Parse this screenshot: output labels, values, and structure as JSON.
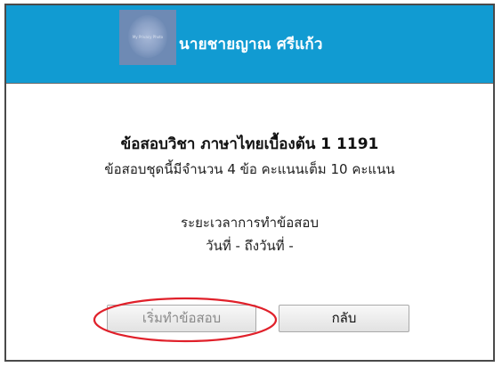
{
  "header": {
    "user_name": "นายชายญาณ ศรีแก้ว",
    "background_color": "#119bd2",
    "avatar": {
      "icon": "user-avatar-icon",
      "caption": "My Privacy Photo"
    }
  },
  "exam": {
    "title": "ข้อสอบวิชา ภาษาไทยเบื้องต้น 1 1191",
    "summary": "ข้อสอบชุดนี้มีจำนวน 4 ข้อ คะแนนเต็ม 10 คะแนน",
    "period_label": "ระยะเวลาการทำข้อสอบ",
    "period_dates": "วันที่ - ถึงวันที่ -"
  },
  "actions": {
    "start_label": "เริ่มทำข้อสอบ",
    "back_label": "กลับ"
  },
  "annotation": {
    "color": "#e0202a"
  }
}
